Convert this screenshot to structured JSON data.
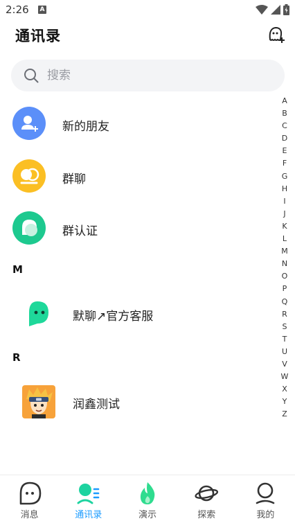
{
  "status_bar": {
    "time": "2:26",
    "notification_badge": "A"
  },
  "header": {
    "title": "通讯录"
  },
  "search": {
    "placeholder": "搜索"
  },
  "shortcuts": [
    {
      "label": "新的朋友",
      "icon": "new-friend-icon",
      "color": "#5b8ff9"
    },
    {
      "label": "群聊",
      "icon": "group-chat-icon",
      "color": "#fbbf24"
    },
    {
      "label": "群认证",
      "icon": "group-verify-icon",
      "color": "#1dc98f"
    }
  ],
  "sections": [
    {
      "letter": "M",
      "contacts": [
        {
          "name": "默聊↗官方客服",
          "avatar": "service-bot-icon"
        }
      ]
    },
    {
      "letter": "R",
      "contacts": [
        {
          "name": "润鑫测试",
          "avatar": "cartoon-avatar"
        }
      ]
    }
  ],
  "alpha_index": [
    "A",
    "B",
    "C",
    "D",
    "E",
    "F",
    "G",
    "H",
    "I",
    "J",
    "K",
    "L",
    "M",
    "N",
    "O",
    "P",
    "Q",
    "R",
    "S",
    "T",
    "U",
    "V",
    "W",
    "X",
    "Y",
    "Z"
  ],
  "tabs": [
    {
      "label": "消息",
      "icon": "chat-bubble-icon",
      "active": false
    },
    {
      "label": "通讯录",
      "icon": "contacts-icon",
      "active": true
    },
    {
      "label": "演示",
      "icon": "flame-icon",
      "active": false
    },
    {
      "label": "探索",
      "icon": "planet-icon",
      "active": false
    },
    {
      "label": "我的",
      "icon": "profile-icon",
      "active": false
    }
  ],
  "colors": {
    "accent": "#1a9bff",
    "green": "#1dc98f",
    "blue": "#5b8ff9",
    "yellow": "#fbbf24"
  }
}
